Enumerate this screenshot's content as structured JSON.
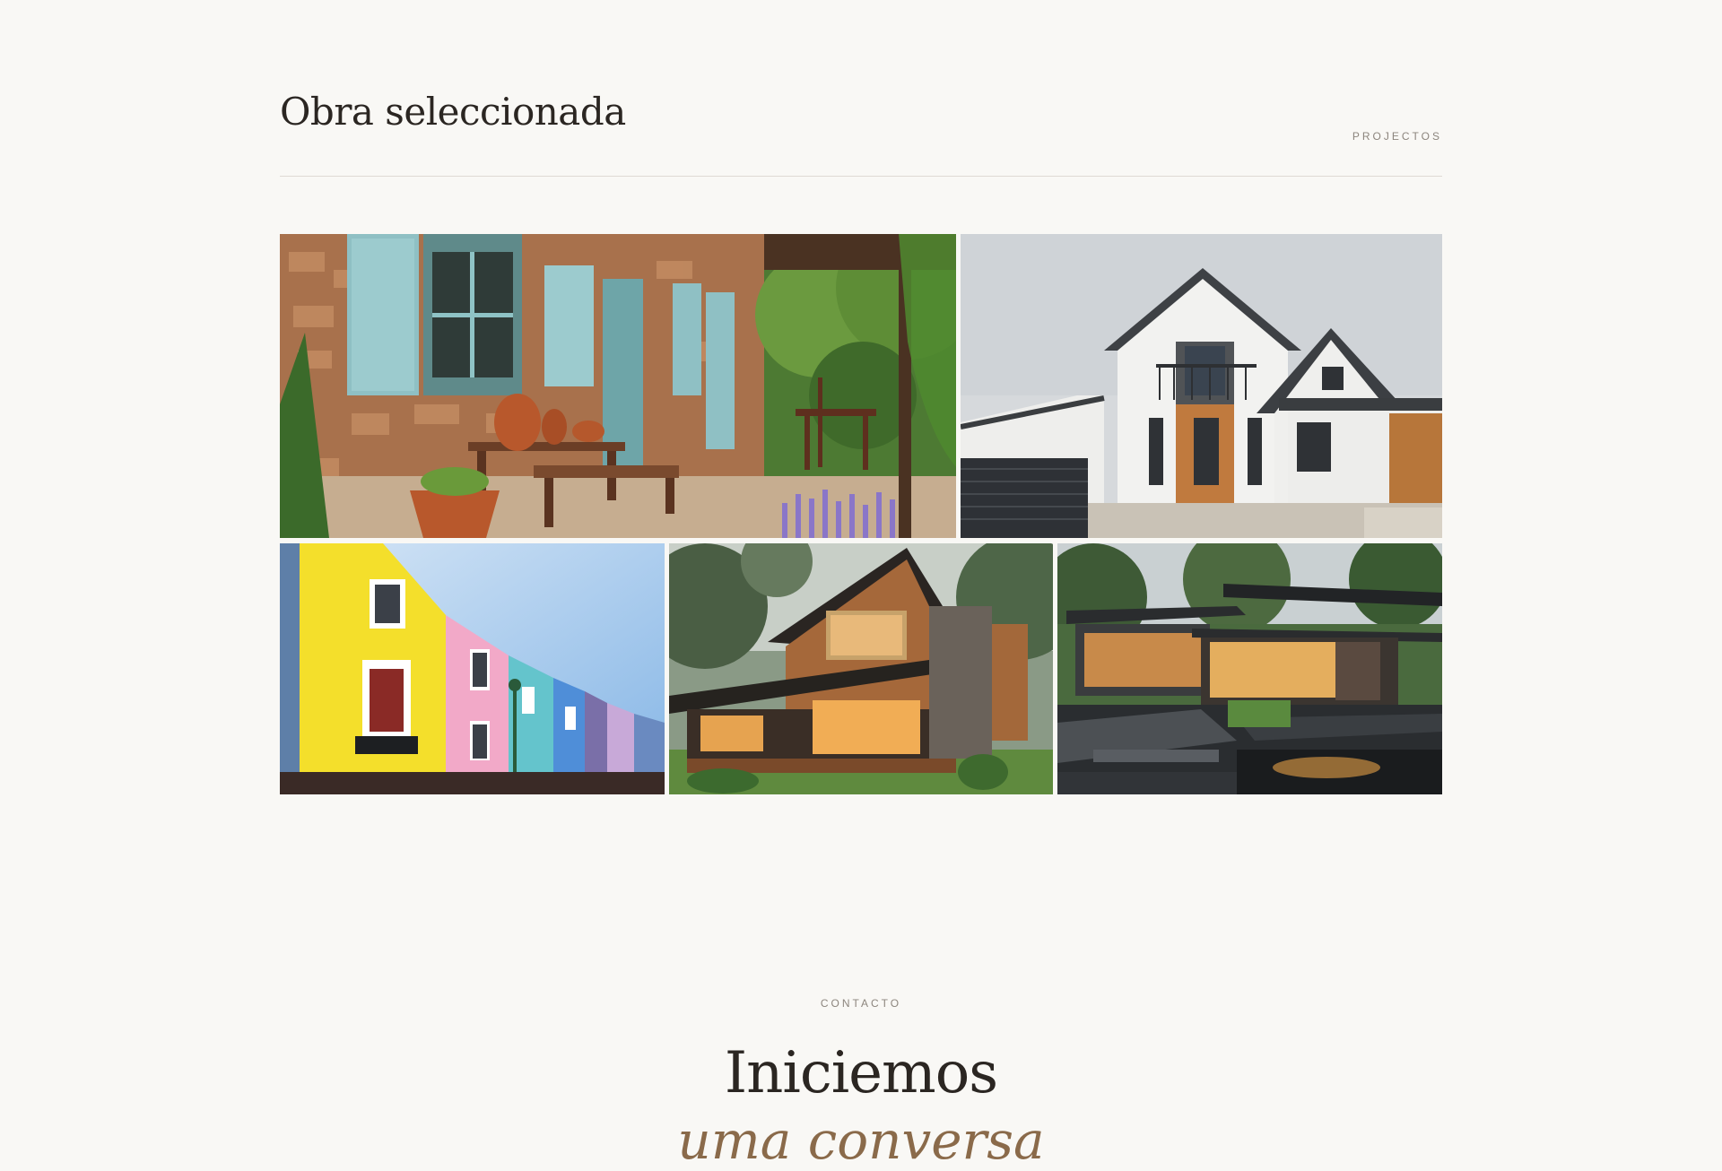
{
  "projects": {
    "title": "Obra seleccionada",
    "tag": "PROJECTOS",
    "gallery": [
      {
        "subject": "rustic stone cottage with blue shutters and terrace"
      },
      {
        "subject": "white modern house with pitched roof and balcony"
      },
      {
        "subject": "colourful terraced townhouses"
      },
      {
        "subject": "timber house in forest at dusk"
      },
      {
        "subject": "contemporary glass pavilion with pond at night"
      }
    ]
  },
  "contact": {
    "tag": "CONTACTO",
    "title": "Iniciemos",
    "subtitle": "uma conversa"
  },
  "colors": {
    "background": "#f9f8f5",
    "text": "#2b2622",
    "muted": "#8c857d",
    "accent": "#8a6a4a",
    "rule": "#dedad3"
  }
}
